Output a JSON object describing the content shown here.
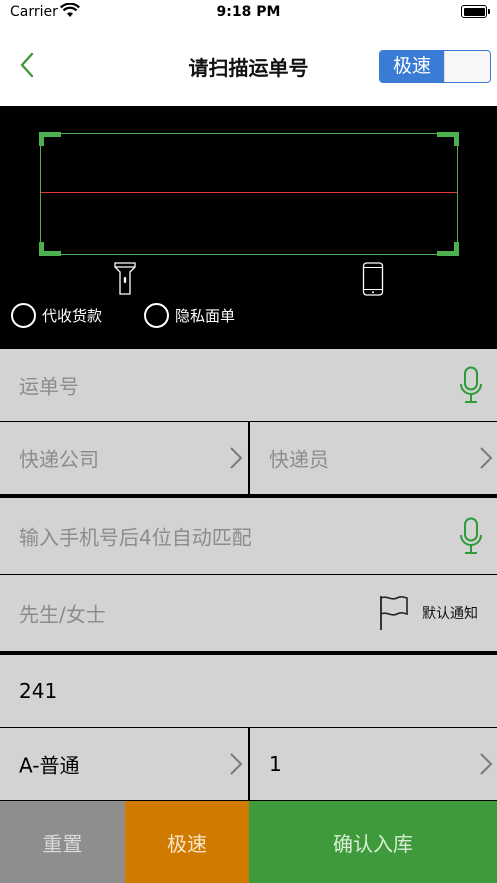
{
  "status_bar": {
    "carrier": "Carrier",
    "time": "9:18 PM"
  },
  "nav": {
    "title": "请扫描运单号",
    "speed_toggle_label": "极速",
    "speed_toggle_on": true
  },
  "scanner": {
    "options": [
      {
        "label": "代收货款",
        "checked": false
      },
      {
        "label": "隐私面单",
        "checked": false
      }
    ]
  },
  "form": {
    "waybill_placeholder": "运单号",
    "courier_company_placeholder": "快递公司",
    "courier_placeholder": "快递员",
    "phone_placeholder": "输入手机号后4位自动匹配",
    "name_placeholder": "先生/女士",
    "default_notify_label": "默认通知",
    "shelf_number": "241",
    "package_type": "A-普通",
    "quantity": "1"
  },
  "actions": {
    "reset": "重置",
    "speed": "极速",
    "confirm": "确认入库"
  },
  "colors": {
    "accent_blue": "#3a7bd5",
    "scan_green": "#4caf50",
    "mic_green": "#2e9b3a",
    "reset_gray": "#8e8e8e",
    "speed_orange": "#d17a00",
    "confirm_green": "#3f9a3c"
  },
  "icons": [
    "back-chevron-icon",
    "flashlight-icon",
    "phone-icon",
    "microphone-icon",
    "chevron-right-icon",
    "flag-icon",
    "wifi-icon",
    "battery-icon"
  ]
}
